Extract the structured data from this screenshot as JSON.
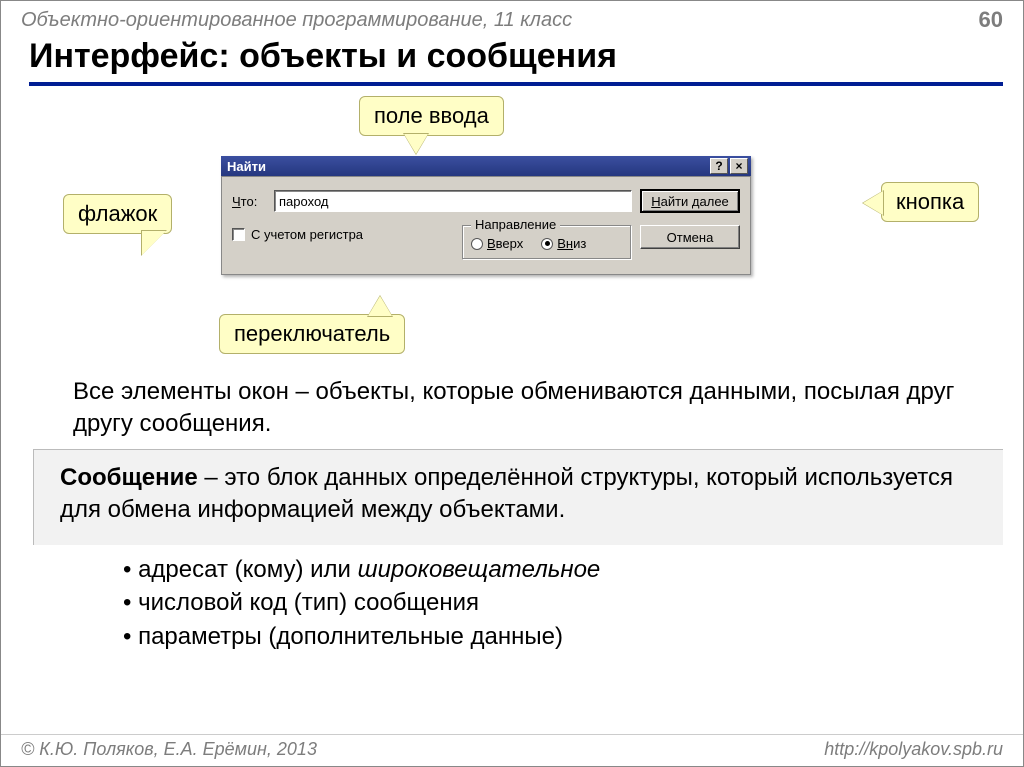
{
  "header": {
    "course": "Объектно-ориентированное программирование, 11 класс",
    "page": "60"
  },
  "title": "Интерфейс: объекты и сообщения",
  "callouts": {
    "input": "поле ввода",
    "checkbox": "флажок",
    "button": "кнопка",
    "radio": "переключатель"
  },
  "dialog": {
    "title": "Найти",
    "help": "?",
    "close": "×",
    "what_label": "Что:",
    "what_prefix": "Ч",
    "what_suffix": "то:",
    "search_value": "пароход",
    "find_next": "Найти далее",
    "find_next_prefix": "Н",
    "find_next_suffix": "айти далее",
    "cancel": "Отмена",
    "case_label": "С учетом регистра",
    "case_prefix": "",
    "case_suffix": "",
    "direction_legend": "Направление",
    "up": "Вверх",
    "up_prefix": "В",
    "up_suffix": "верх",
    "down": "Вниз",
    "down_prefix": "Вн",
    "down_suffix": "из"
  },
  "body": {
    "para": "Все элементы окон – объекты, которые обмениваются данными, посылая друг другу сообщения.",
    "definition_term": "Сообщение",
    "definition_rest": " – это блок данных определённой структуры, который используется для обмена информацией между объектами.",
    "bullets": [
      {
        "pre": "адресат (кому) или ",
        "em": "широковещательное",
        "post": ""
      },
      {
        "pre": "числовой код (тип) сообщения",
        "em": "",
        "post": ""
      },
      {
        "pre": "параметры (дополнительные данные)",
        "em": "",
        "post": ""
      }
    ]
  },
  "footer": {
    "left": "© К.Ю. Поляков, Е.А. Ерёмин, 2013",
    "right": "http://kpolyakov.spb.ru"
  }
}
